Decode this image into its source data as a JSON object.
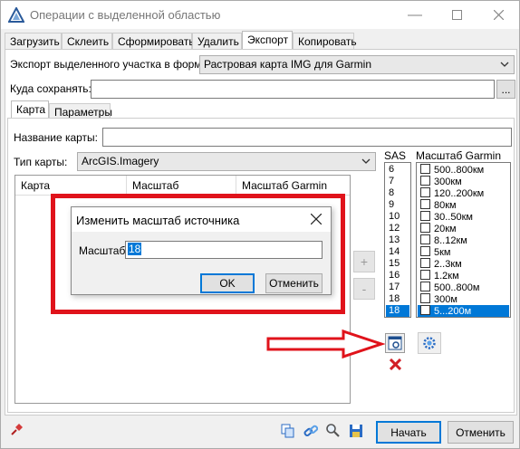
{
  "window": {
    "title": "Операции с выделенной областью",
    "accent": "#0078d7",
    "highlight_color": "#e0131b"
  },
  "top_tabs": [
    "Загрузить",
    "Склеить",
    "Сформировать",
    "Удалить",
    "Экспорт",
    "Копировать"
  ],
  "export": {
    "format_label": "Экспорт выделенного участка в формат",
    "format_value": "Растровая карта IMG для Garmin",
    "save_label": "Куда сохранять:",
    "save_value": "",
    "browse_label": "..."
  },
  "sub_tabs": [
    "Карта",
    "Параметры"
  ],
  "map": {
    "name_label": "Название карты:",
    "name_value": "",
    "type_label": "Тип карты:",
    "type_value": "ArcGIS.Imagery",
    "columns": [
      "Карта",
      "Масштаб",
      "Масштаб Garmin"
    ]
  },
  "sas": {
    "header": "SAS",
    "items": [
      "6",
      "7",
      "8",
      "9",
      "10",
      "12",
      "13",
      "14",
      "15",
      "16",
      "17",
      "18",
      "18"
    ],
    "selected_index": 12
  },
  "garmin": {
    "header": "Масштаб Garmin",
    "items": [
      "500..800км",
      "300км",
      "120..200км",
      "80км",
      "30..50км",
      "20км",
      "8..12км",
      "5км",
      "2..3км",
      "1.2км",
      "500..800м",
      "300м",
      "5...200м"
    ],
    "selected_index": 12
  },
  "side_buttons": {
    "plus": "+",
    "minus": "-"
  },
  "dialog": {
    "title": "Изменить масштаб источника",
    "scale_label": "Масштаб",
    "scale_value": "18",
    "ok_label": "OK",
    "cancel_label": "Отменить"
  },
  "footer": {
    "start_label": "Начать",
    "cancel_label": "Отменить"
  }
}
